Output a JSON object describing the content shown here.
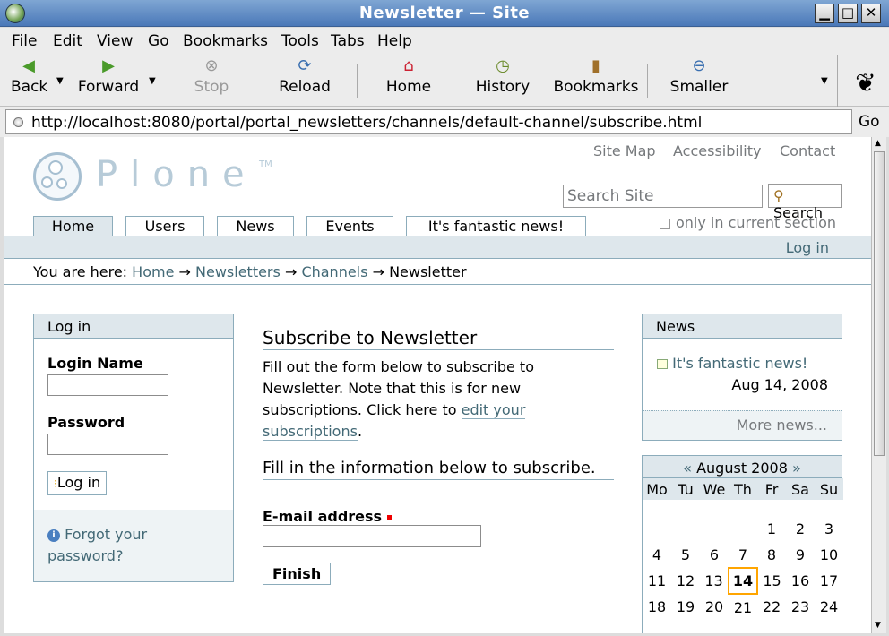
{
  "window": {
    "title": "Newsletter — Site"
  },
  "menu": [
    "File",
    "Edit",
    "View",
    "Go",
    "Bookmarks",
    "Tools",
    "Tabs",
    "Help"
  ],
  "toolbar": {
    "back": "Back",
    "forward": "Forward",
    "stop": "Stop",
    "reload": "Reload",
    "home": "Home",
    "history": "History",
    "bookmarks": "Bookmarks",
    "smaller": "Smaller"
  },
  "url": {
    "value": "http://localhost:8080/portal/portal_newsletters/channels/default-channel/subscribe.html",
    "go": "Go"
  },
  "logo": {
    "text": "Plone",
    "tm": "TM"
  },
  "site_actions": [
    "Site Map",
    "Accessibility",
    "Contact"
  ],
  "search": {
    "placeholder": "Search Site",
    "button": "Search",
    "current_section": "only in current section"
  },
  "tabs": [
    "Home",
    "Users",
    "News",
    "Events",
    "It's fantastic news!"
  ],
  "personal": {
    "login": "Log in"
  },
  "breadcrumbs": {
    "prefix": "You are here:",
    "items": [
      "Home",
      "Newsletters",
      "Channels"
    ],
    "current": "Newsletter",
    "sep": "→"
  },
  "login_portlet": {
    "title": "Log in",
    "login_name": "Login Name",
    "password": "Password",
    "button": "Log in",
    "forgot": "Forgot your password?"
  },
  "content": {
    "title": "Subscribe to Newsletter",
    "desc_pre": "Fill out the form below to subscribe to Newsletter. Note that this is for new subscriptions. Click here to ",
    "desc_link": "edit your subscriptions",
    "desc_post": ".",
    "subtitle": "Fill in the information below to subscribe.",
    "email_label": "E-mail address",
    "finish": "Finish"
  },
  "news_portlet": {
    "title": "News",
    "item": "It's fantastic news!",
    "date": "Aug 14, 2008",
    "more": "More news..."
  },
  "calendar": {
    "prev": "«",
    "next": "»",
    "month": "August 2008",
    "days": [
      "Mo",
      "Tu",
      "We",
      "Th",
      "Fr",
      "Sa",
      "Su"
    ],
    "weeks": [
      [
        "",
        "",
        "",
        "",
        "1",
        "2",
        "3"
      ],
      [
        "4",
        "5",
        "6",
        "7",
        "8",
        "9",
        "10"
      ],
      [
        "11",
        "12",
        "13",
        "14",
        "15",
        "16",
        "17"
      ],
      [
        "18",
        "19",
        "20",
        "21",
        "22",
        "23",
        "24"
      ]
    ],
    "today": "14"
  }
}
